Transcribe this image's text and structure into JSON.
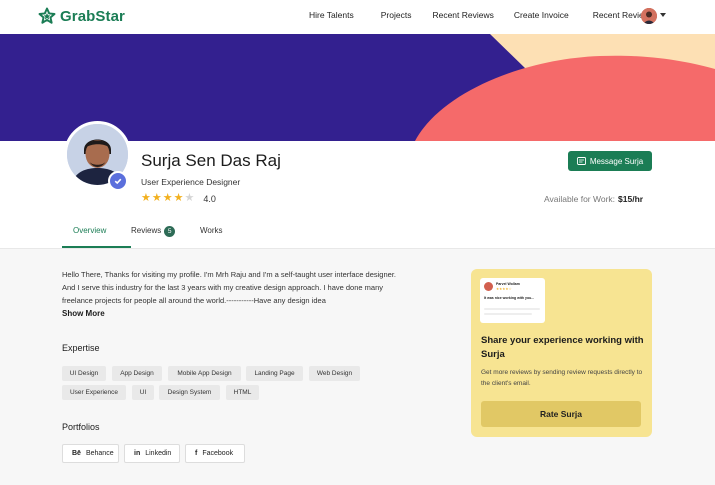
{
  "brand": {
    "name": "GrabStar",
    "color": "#1b7d55"
  },
  "nav": {
    "links": [
      "Hire Talents",
      "Projects",
      "Recent Reviews",
      "Create Invoice",
      "Recent Reviews"
    ]
  },
  "colors": {
    "banner": "#33208f",
    "banner_coral": "#f56a6a",
    "banner_peach": "#fde0b4",
    "card": "#f7e492"
  },
  "profile": {
    "name": "Surja Sen Das Raj",
    "title": "User Experience Designer",
    "rating": "4.0",
    "stars_filled": 4,
    "stars_total": 5,
    "message_label": "Message Surja",
    "availability_label": "Available for Work:",
    "rate": "$15/hr"
  },
  "tabs": [
    {
      "label": "Overview",
      "active": true
    },
    {
      "label": "Reviews",
      "badge": "5"
    },
    {
      "label": "Works"
    }
  ],
  "bio": {
    "text": "Hello There, Thanks for visiting my profile. I'm Mrh Raju and I'm a self-taught user interface designer. And I serve this industry for the last 3 years with my creative design approach. I have done many freelance projects for people all around the world.-----------Have any design idea",
    "show_more": "Show More"
  },
  "expertise": {
    "title": "Expertise",
    "tags": [
      "UI Design",
      "App Design",
      "Mobile App Design",
      "Landing Page",
      "Web Design",
      "User Experience",
      "UI",
      "Design System",
      "HTML"
    ]
  },
  "portfolios": {
    "title": "Portfolios",
    "items": [
      {
        "label": "Behance",
        "icon": "behance-icon",
        "glyph": "Bē"
      },
      {
        "label": "Linkedin",
        "icon": "linkedin-icon",
        "glyph": "in"
      },
      {
        "label": "Facebook",
        "icon": "facebook-icon",
        "glyph": "f"
      }
    ]
  },
  "share_card": {
    "mini_name": "Parvel Wollam",
    "mini_text": "It was nice working with you...",
    "title": "Share your experience working with Surja",
    "description": "Get more reviews by sending review requests directly to the client's email.",
    "button": "Rate Surja"
  }
}
